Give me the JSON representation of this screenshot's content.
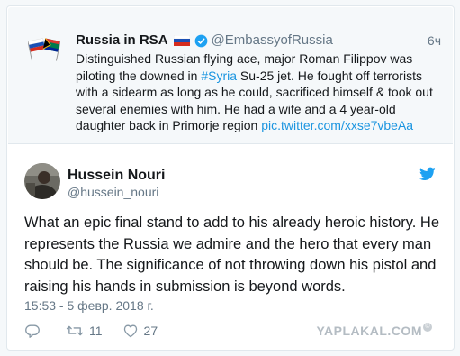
{
  "quoted": {
    "name": "Russia in RSA",
    "handle": "@EmbassyofRussia",
    "time": "6ч",
    "text_before_hashtag": "Distinguished Russian flying ace, major Roman Filippov was piloting the downed in ",
    "hashtag": "#Syria",
    "text_after_hashtag": " Su-25 jet. He fought off terrorists with a sidearm as long as he could, sacrificed himself & took out several enemies with him. He had a wife and a 4 year-old daughter back in Primorje region ",
    "pic_link": "pic.twitter.com/xxse7vbeAa",
    "avatar_icon": "russia-south-africa-flags-icon",
    "flag_icon": "russia-flag-icon",
    "verified_icon": "verified-badge-icon"
  },
  "tweet": {
    "name": "Hussein Nouri",
    "handle": "@hussein_nouri",
    "text": "What an epic final stand to add to his already heroic history. He represents the Russia we admire and the hero that every man should be. The significance of not throwing down his pistol and raising his hands in submission is beyond words.",
    "date": "15:53 - 5 февр. 2018 г.",
    "retweets": "11",
    "likes": "27",
    "avatar_icon": "profile-photo-avatar",
    "logo_icon": "twitter-bird-icon"
  },
  "actions": {
    "reply_icon": "reply-icon",
    "retweet_icon": "retweet-icon",
    "like_icon": "heart-icon"
  },
  "watermark": {
    "text": "YAPLAKAL.COM"
  },
  "colors": {
    "link": "#1b95e0",
    "text": "#14171a",
    "muted": "#657786",
    "border": "#e1e8ed",
    "quoted_bg": "#f5f8fa"
  }
}
